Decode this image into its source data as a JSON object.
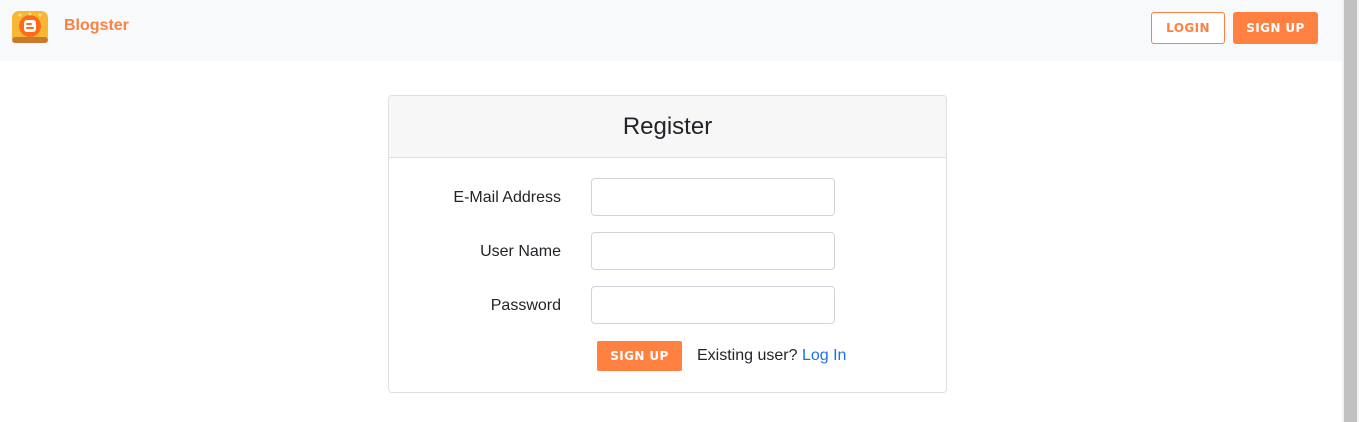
{
  "navbar": {
    "brand": "Blogster",
    "login_label": "LOGIN",
    "signup_label": "SIGN UP"
  },
  "colors": {
    "accent": "#ff8040",
    "link": "#1a73e8"
  },
  "register": {
    "title": "Register",
    "fields": [
      {
        "label": "E-Mail Address",
        "value": "",
        "placeholder": ""
      },
      {
        "label": "User Name",
        "value": "",
        "placeholder": ""
      },
      {
        "label": "Password",
        "value": "",
        "placeholder": ""
      }
    ],
    "submit_label": "SIGN UP",
    "existing_text": "Existing user?",
    "login_link": "Log In"
  }
}
